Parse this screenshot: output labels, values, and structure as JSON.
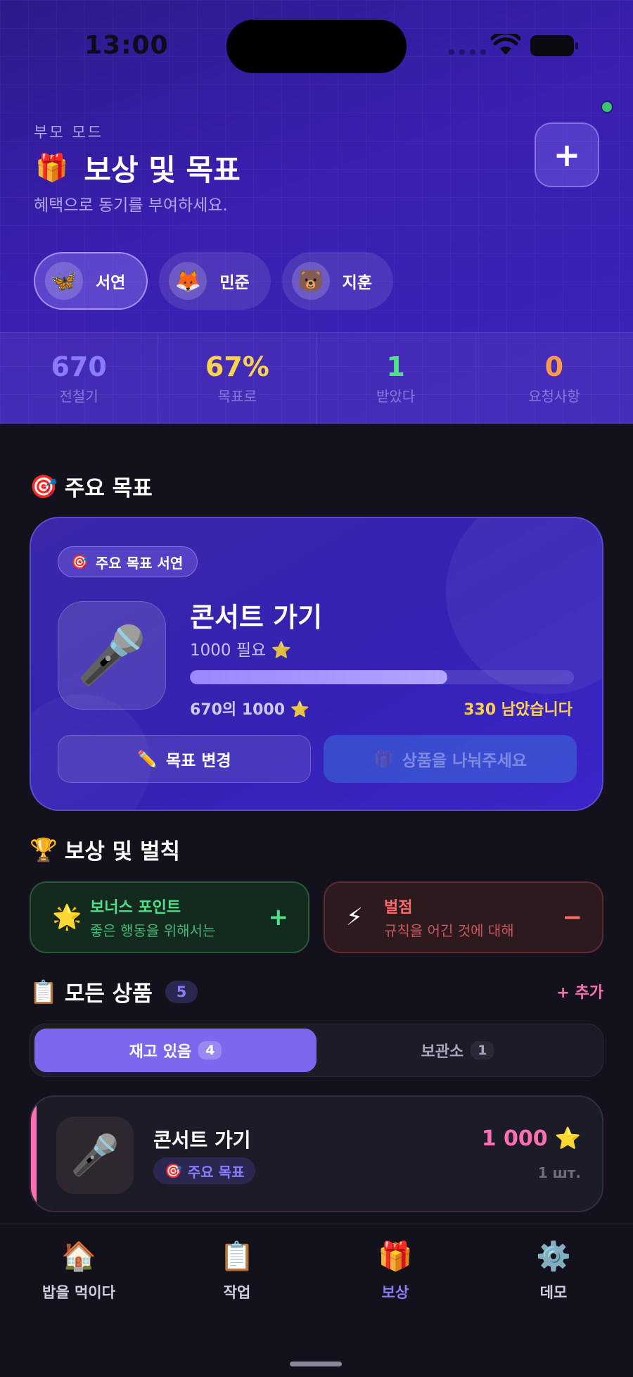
{
  "status_bar": {
    "time": "13:00"
  },
  "header": {
    "mode_label": "부모 모드",
    "title_icon": "🎁",
    "title": "보상 및 목표",
    "subtitle": "혜택으로 동기를 부여하세요.",
    "add_button": "+"
  },
  "children": [
    {
      "emoji": "🦋",
      "name": "서연",
      "active": true
    },
    {
      "emoji": "🦊",
      "name": "민준",
      "active": false
    },
    {
      "emoji": "🐻",
      "name": "지훈",
      "active": false
    }
  ],
  "stats": [
    {
      "value": "670",
      "label": "전철기",
      "color": "#8b7bff"
    },
    {
      "value": "67%",
      "label": "목표로",
      "color": "#ffd24d"
    },
    {
      "value": "1",
      "label": "받았다",
      "color": "#4fe08a"
    },
    {
      "value": "0",
      "label": "요청사항",
      "color": "#ff9a4d"
    }
  ],
  "main_goal": {
    "section_icon": "🎯",
    "section_title": "주요 목표",
    "badge_icon": "🎯",
    "badge_text": "주요 목표 서연",
    "icon": "🎤",
    "name": "콘서트 가기",
    "need_text": "1000 필요 ⭐",
    "progress": 0.67,
    "progress_text": "670의 1000 ⭐",
    "remaining_text": "330 남았습니다",
    "change_icon": "✏️",
    "change_label": "목표 변경",
    "give_icon": "🎁",
    "give_label": "상품을 나눠주세요"
  },
  "rewards_penalties": {
    "section_icon": "🏆",
    "section_title": "보상 및 벌칙",
    "bonus": {
      "icon": "🌟",
      "title": "보너스 포인트",
      "desc": "좋은 행동을 위해서는",
      "sign": "+"
    },
    "penalty": {
      "icon": "⚡",
      "title": "벌점",
      "desc": "규칙을 어긴 것에 대해",
      "sign": "−"
    }
  },
  "products": {
    "section_icon": "📋",
    "section_title": "모든 상품",
    "count": "5",
    "add_label": "+ 추가",
    "tabs": [
      {
        "label": "재고 있음",
        "count": "4",
        "active": true
      },
      {
        "label": "보관소",
        "count": "1",
        "active": false
      }
    ],
    "items": [
      {
        "icon": "🎤",
        "name": "콘서트 가기",
        "tag_icon": "🎯",
        "tag": "주요 목표",
        "price": "1 000",
        "price_icon": "⭐",
        "qty": "1 шт."
      }
    ]
  },
  "tabbar": [
    {
      "icon": "🏠",
      "label": "밥을 먹이다",
      "active": false
    },
    {
      "icon": "📋",
      "label": "작업",
      "active": false
    },
    {
      "icon": "🎁",
      "label": "보상",
      "active": true
    },
    {
      "icon": "⚙️",
      "label": "데모",
      "active": false
    }
  ]
}
